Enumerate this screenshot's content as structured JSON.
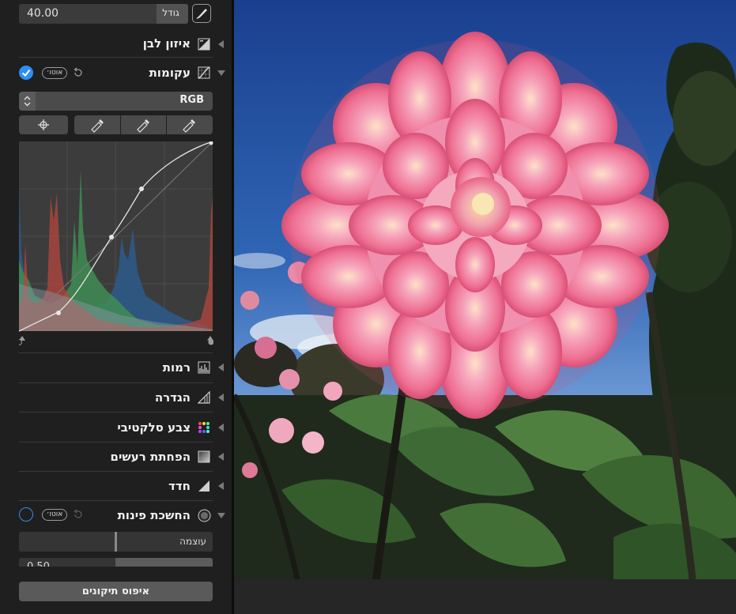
{
  "size_row": {
    "value": "40.00",
    "label": "גודל"
  },
  "sections": {
    "white_balance": "איזון לבן",
    "curves": "עקומות",
    "levels": "רמות",
    "definition": "הגדרה",
    "selective_color": "צבע סלקטיבי",
    "noise_reduction": "הפחתת רעשים",
    "sharpen": "חדד",
    "vignette": "החשכת פינות"
  },
  "auto_label": "אוטו׳",
  "curves": {
    "channel": "RGB"
  },
  "vignette": {
    "intensity_label": "עוצמה",
    "radius_value": "0.50"
  },
  "reset_button": "איפוס תיקונים",
  "icons": {
    "size_icon": "brush-icon",
    "white_balance_icon": "white-balance-icon",
    "curves_icon": "curves-icon",
    "levels_icon": "levels-icon",
    "definition_icon": "definition-icon",
    "selective_color_icon": "selective-color-icon",
    "noise_icon": "noise-reduction-icon",
    "sharpen_icon": "sharpen-icon",
    "vignette_icon": "vignette-icon",
    "eyedroppers": [
      "eyedropper-black-icon",
      "eyedropper-gray-icon",
      "eyedropper-white-icon"
    ],
    "target": "crosshair-icon"
  },
  "colors": {
    "accent": "#2f8ef4",
    "panel": "#1f1f1f",
    "button": "#4a4a4a"
  }
}
